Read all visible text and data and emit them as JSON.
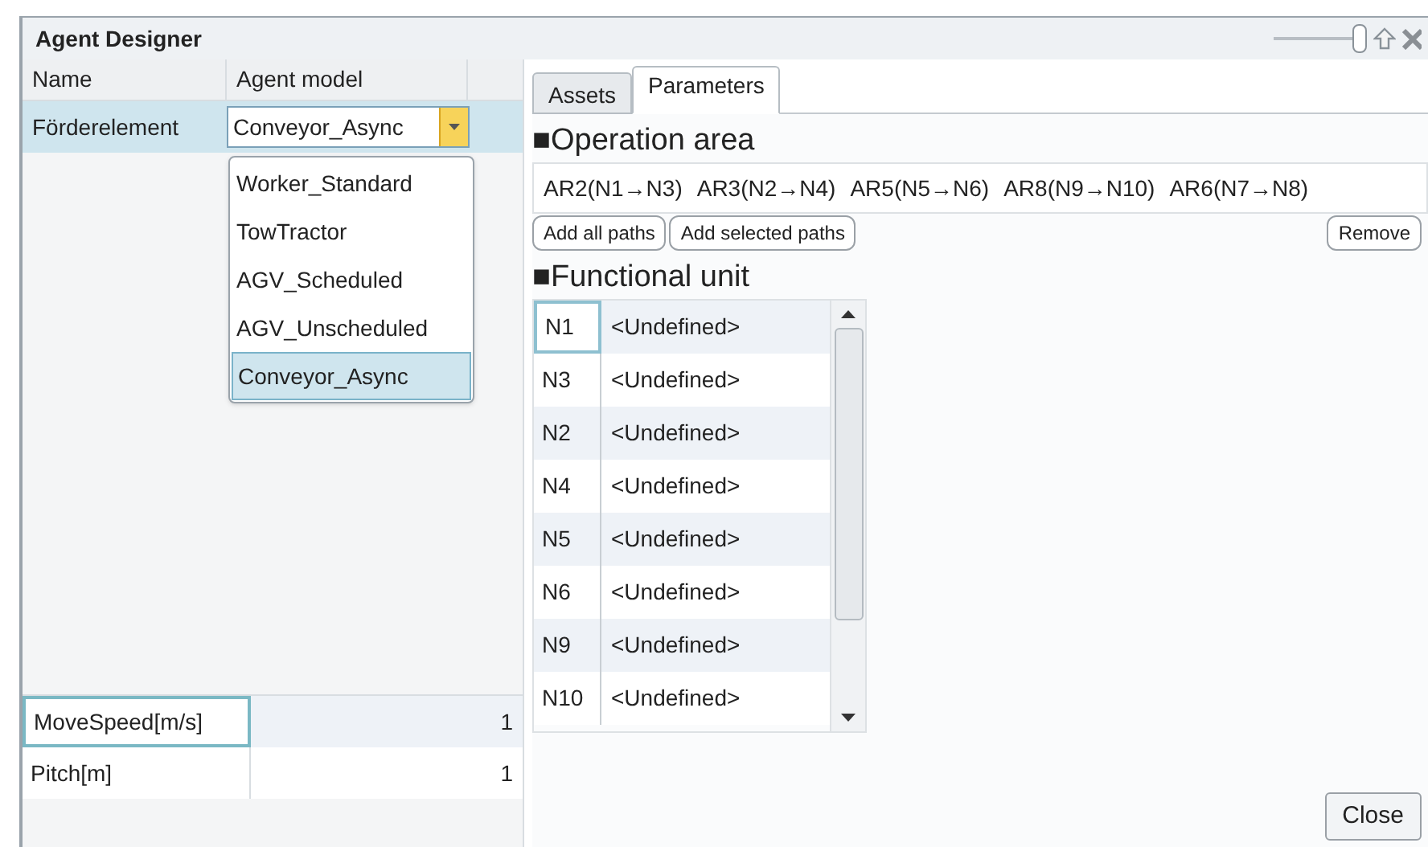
{
  "window": {
    "title": "Agent Designer",
    "zoom_slider": {
      "level": 1
    }
  },
  "agents": {
    "columns": [
      "Name",
      "Agent model"
    ],
    "rows": [
      {
        "name": "Förderelement",
        "model": "Conveyor_Async",
        "selected": true
      }
    ],
    "dropdown": {
      "expanded": true,
      "options": [
        {
          "label": "Worker_Standard",
          "selected": false
        },
        {
          "label": "TowTractor",
          "selected": false
        },
        {
          "label": "AGV_Scheduled",
          "selected": false
        },
        {
          "label": "AGV_Unscheduled",
          "selected": false
        },
        {
          "label": "Conveyor_Async",
          "selected": true
        }
      ]
    }
  },
  "properties": [
    {
      "name": "MoveSpeed[m/s]",
      "value": "1",
      "selected": true
    },
    {
      "name": "Pitch[m]",
      "value": "1",
      "selected": false
    }
  ],
  "tabs": [
    {
      "label": "Assets",
      "selected": false
    },
    {
      "label": "Parameters",
      "selected": true
    }
  ],
  "operation_area": {
    "heading": "■Operation area",
    "paths": [
      "AR2(N1→N3)",
      "AR3(N2→N4)",
      "AR5(N5→N6)",
      "AR8(N9→N10)",
      "AR6(N7→N8)"
    ],
    "buttons": [
      "Add all paths",
      "Add selected paths"
    ],
    "remove_button": "Remove"
  },
  "functional_unit": {
    "heading": "■Functional unit",
    "rows": [
      {
        "node": "N1",
        "unit": "<Undefined>",
        "selected": true
      },
      {
        "node": "N3",
        "unit": "<Undefined>",
        "selected": false
      },
      {
        "node": "N2",
        "unit": "<Undefined>",
        "selected": false
      },
      {
        "node": "N4",
        "unit": "<Undefined>",
        "selected": false
      },
      {
        "node": "N5",
        "unit": "<Undefined>",
        "selected": false
      },
      {
        "node": "N6",
        "unit": "<Undefined>",
        "selected": false
      },
      {
        "node": "N9",
        "unit": "<Undefined>",
        "selected": false
      },
      {
        "node": "N10",
        "unit": "<Undefined>",
        "selected": false
      }
    ]
  },
  "close_button": "Close"
}
